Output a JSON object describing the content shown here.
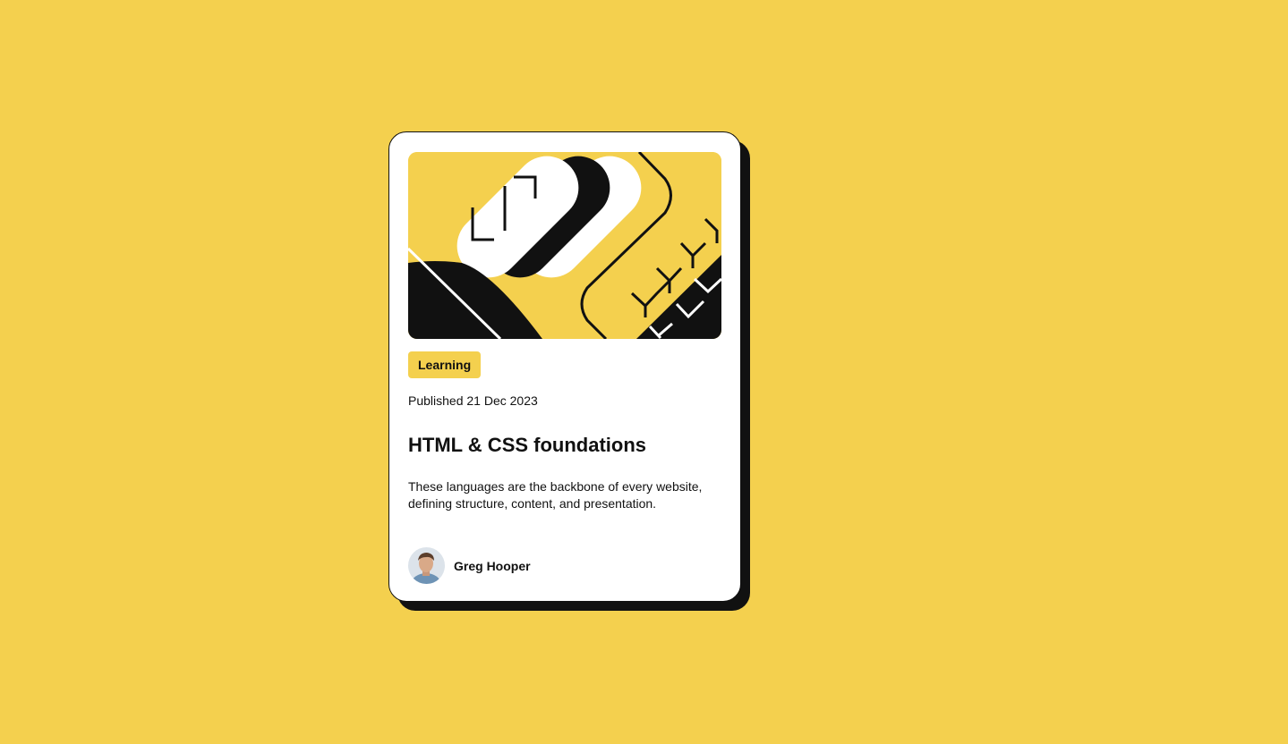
{
  "card": {
    "tag": "Learning",
    "published": "Published 21 Dec 2023",
    "title": "HTML & CSS foundations",
    "description": "These languages are the backbone of every website, defining structure, content, and presentation.",
    "author": {
      "name": "Greg Hooper"
    }
  },
  "theme": {
    "background": "#F4D04E",
    "card_background": "#FFFFFF",
    "ink": "#111111"
  },
  "icons": {
    "hero": "abstract-code-illustration",
    "avatar": "author-avatar-photo"
  }
}
